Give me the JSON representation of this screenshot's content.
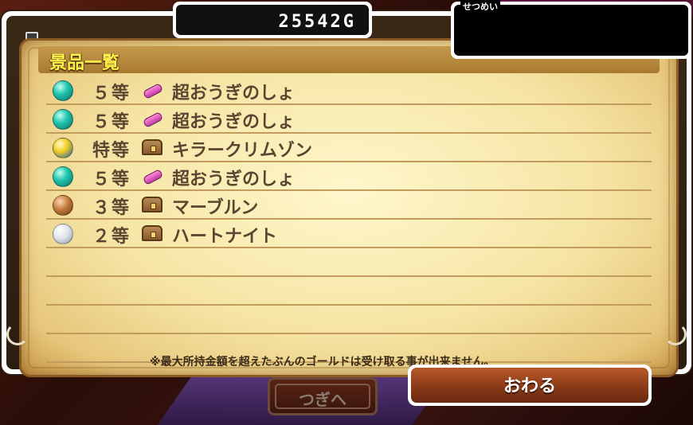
{
  "gold": {
    "value": "25542G"
  },
  "description": {
    "label": "せつめい"
  },
  "prize_list": {
    "header": "景品一覧",
    "rows": [
      {
        "orb": "teal",
        "rank": "５等",
        "icon": "scroll-icon",
        "name": "超おうぎのしょ"
      },
      {
        "orb": "teal",
        "rank": "５等",
        "icon": "scroll-icon",
        "name": "超おうぎのしょ"
      },
      {
        "orb": "gold",
        "rank": "特等",
        "icon": "chest-icon",
        "name": "キラークリムゾン"
      },
      {
        "orb": "teal",
        "rank": "５等",
        "icon": "scroll-icon",
        "name": "超おうぎのしょ"
      },
      {
        "orb": "bronze",
        "rank": "３等",
        "icon": "chest-icon",
        "name": "マーブルン"
      },
      {
        "orb": "silver",
        "rank": "２等",
        "icon": "chest-icon",
        "name": "ハートナイト"
      }
    ],
    "notice": "※最大所持金額を超えたぶんのゴールドは受け取る事が出来ません。"
  },
  "buttons": {
    "close": "おわる",
    "next": "つぎへ"
  },
  "colors": {
    "header_text": "#fff24a",
    "item_text": "#5a4530",
    "parchment": "#f5e4a3"
  }
}
